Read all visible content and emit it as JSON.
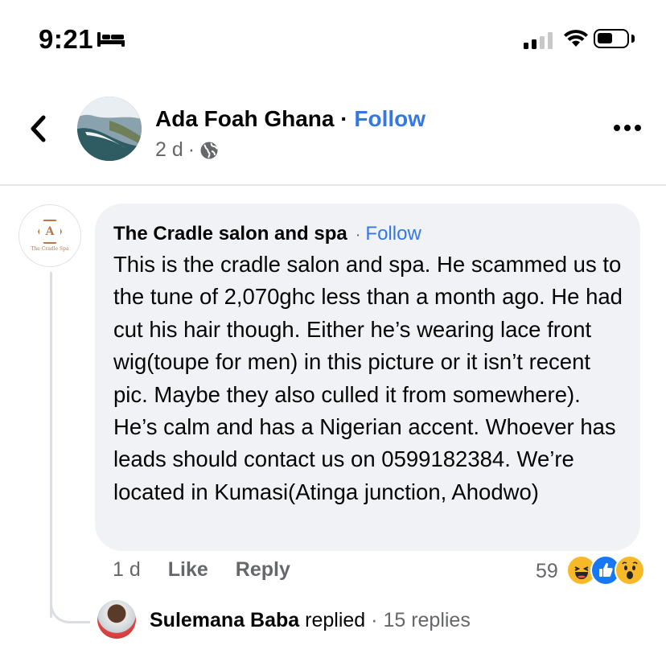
{
  "status_bar": {
    "time": "9:21",
    "sleep_icon": "bed-icon",
    "signal_icon": "cellular-signal-icon",
    "wifi_icon": "wifi-icon",
    "battery_icon": "battery-icon",
    "battery_level": 0.45
  },
  "header": {
    "back_icon": "chevron-left-icon",
    "page_name": "Ada Foah Ghana",
    "separator": "·",
    "follow_label": "Follow",
    "posted_ago": "2 d",
    "meta_separator": "·",
    "audience_icon": "globe-icon",
    "more_icon": "more-horizontal-icon"
  },
  "comment": {
    "author": "The Cradle salon and spa",
    "avatar_logo_text": "The Cradle Spa",
    "separator": "·",
    "follow_label": "Follow",
    "text": "This is the cradle salon and spa. He scammed us to the tune of 2,070ghc less than a month ago. He had cut his hair though. Either he’s wearing lace front wig(toupe for men) in this picture or it isn’t recent pic. Maybe they also culled it from somewhere). He’s calm  and has a Nigerian accent. Whoever has leads should contact us on 0599182384. We’re located in Kumasi(Atinga junction, Ahodwo)",
    "posted_ago": "1 d",
    "like_label": "Like",
    "reply_label": "Reply",
    "reaction_count": "59",
    "reactions": [
      "haha-icon",
      "like-icon",
      "wow-icon"
    ]
  },
  "reply_summary": {
    "name": "Sulemana Baba",
    "action": "replied",
    "separator": "·",
    "count_label": "15 replies"
  }
}
